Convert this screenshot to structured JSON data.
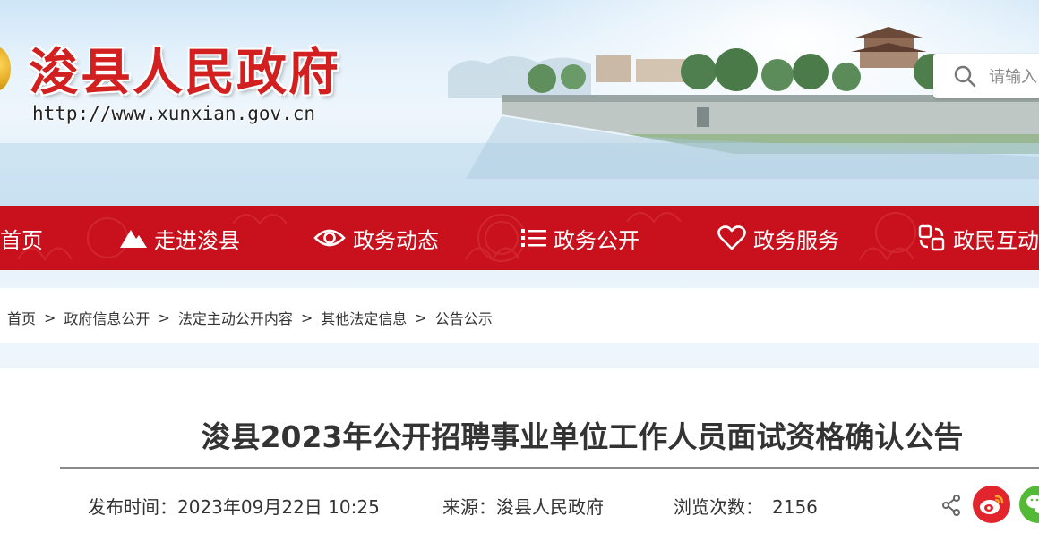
{
  "header": {
    "site_title": "浚县人民政府",
    "site_url": "http://www.xunxian.gov.cn",
    "search_placeholder": "请输入"
  },
  "nav": {
    "items": [
      {
        "label": "首页",
        "icon": "none"
      },
      {
        "label": "走进浚县",
        "icon": "mountain-icon"
      },
      {
        "label": "政务动态",
        "icon": "eye-icon"
      },
      {
        "label": "政务公开",
        "icon": "list-icon"
      },
      {
        "label": "政务服务",
        "icon": "heart-icon"
      },
      {
        "label": "政民互动",
        "icon": "exchange-icon"
      }
    ]
  },
  "breadcrumb": {
    "items": [
      "首页",
      "政府信息公开",
      "法定主动公开内容",
      "其他法定信息",
      "公告公示"
    ],
    "separator": ">"
  },
  "article": {
    "title": "浚县2023年公开招聘事业单位工作人员面试资格确认公告",
    "published_label": "发布时间：",
    "published_value": "2023年09月22日 10:25",
    "source_label": "来源：",
    "source_value": "浚县人民政府",
    "views_label": "浏览次数：",
    "views_value": "2156"
  },
  "colors": {
    "brand_red": "#c8111c",
    "title_red": "#d21f1f",
    "weibo_red": "#e2252c",
    "wechat_green": "#54b936"
  }
}
